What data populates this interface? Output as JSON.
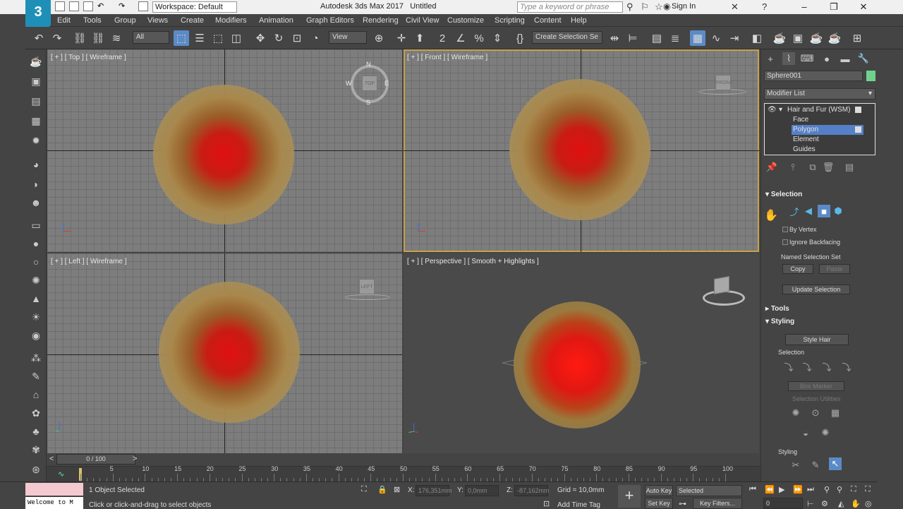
{
  "titlebar": {
    "workspace": "Workspace: Default",
    "app_title": "Autodesk 3ds Max 2017",
    "file_title": "Untitled",
    "search_placeholder": "Type a keyword or phrase",
    "sign_in": "Sign In",
    "logo": "3"
  },
  "menu": [
    "Edit",
    "Tools",
    "Group",
    "Views",
    "Create",
    "Modifiers",
    "Animation",
    "Graph Editors",
    "Rendering",
    "Civil View",
    "Customize",
    "Scripting",
    "Content",
    "Help"
  ],
  "toolbar": {
    "filter": "All",
    "ref_coord": "View",
    "named_selection": "Create Selection Se"
  },
  "viewports": [
    {
      "label": "[ + ] [ Top ] [ Wireframe ]",
      "cube": "TOP"
    },
    {
      "label": "[ + ] [ Front ] [ Wireframe ]",
      "cube": "FRONT"
    },
    {
      "label": "[ + ] [ Left ] [ Wireframe ]",
      "cube": "LEFT"
    },
    {
      "label": "[ + ] [ Perspective ] [ Smooth + Highlights ]",
      "cube": ""
    }
  ],
  "compass": {
    "n": "N",
    "s": "S",
    "e": "E",
    "w": "W"
  },
  "panel": {
    "object_name": "Sphere001",
    "object_color": "#6fd28c",
    "modifier_list": "Modifier List",
    "stack": [
      "Hair and Fur (WSM)",
      "Face",
      "Polygon",
      "Element",
      "Guides"
    ],
    "selection": {
      "title": "Selection",
      "by_vertex": "By Vertex",
      "ignore_backfacing": "Ignore Backfacing",
      "named_sel": "Named Selection Set",
      "copy": "Copy",
      "paste": "Paste",
      "update": "Update Selection"
    },
    "tools_title": "Tools",
    "styling": {
      "title": "Styling",
      "style_hair": "Style Hair",
      "selection": "Selection",
      "box_marker": "Box Marker",
      "selection_utilities": "Selection Utilities",
      "styling_sub": "Styling"
    }
  },
  "timeline": {
    "frame": "0 / 100",
    "ticks": [
      0,
      5,
      10,
      15,
      20,
      25,
      30,
      35,
      40,
      45,
      50,
      55,
      60,
      65,
      70,
      75,
      80,
      85,
      90,
      95,
      100
    ]
  },
  "status": {
    "script_listener": "Welcome to M",
    "objects_selected": "1 Object Selected",
    "prompt": "Click or click-and-drag to select objects",
    "x": "176,351mm",
    "y": "0,0mm",
    "z": "-87,162mm",
    "x_label": "X:",
    "y_label": "Y:",
    "z_label": "Z:",
    "grid": "Grid = 10,0mm",
    "add_time_tag": "Add Time Tag",
    "auto_key": "Auto Key",
    "selected": "Selected",
    "set_key": "Set Key",
    "key_filters": "Key Filters...",
    "frame_field": "0"
  }
}
